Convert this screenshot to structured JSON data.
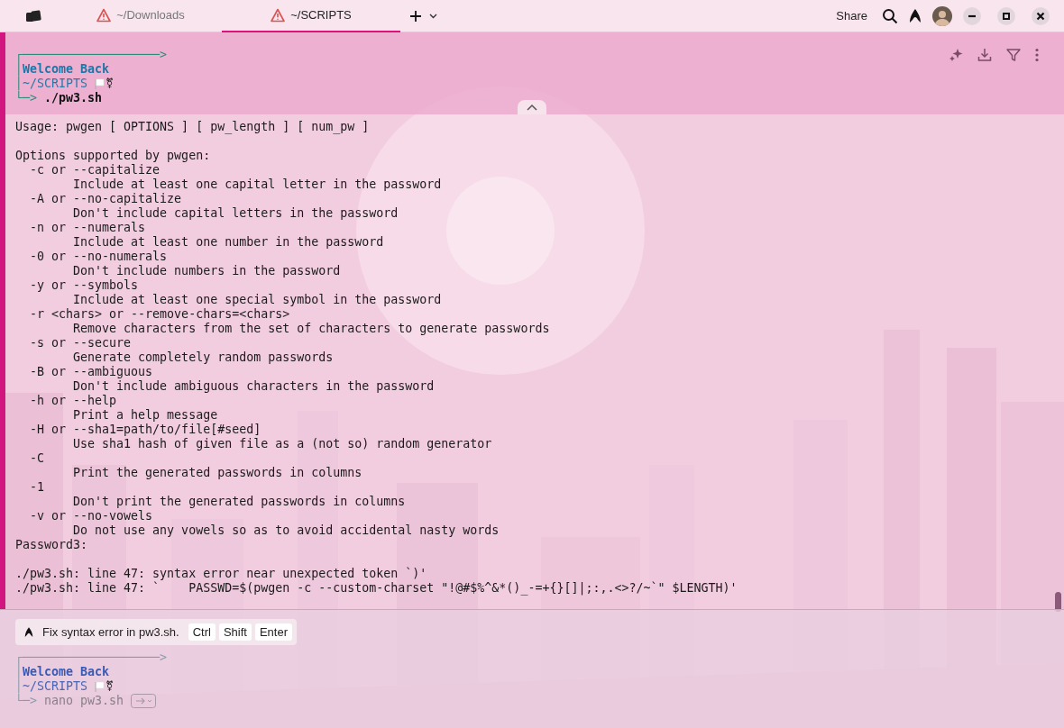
{
  "tabs": [
    {
      "label": "~/Downloads",
      "selected": false
    },
    {
      "label": "~/SCRIPTS",
      "selected": true
    }
  ],
  "titlebar": {
    "share": "Share"
  },
  "block": {
    "prompt": {
      "top": "┌───────────────────>",
      "greeting_prefix": "│",
      "greeting": "Welcome Back",
      "path_prefix": "│",
      "path": "~/SCRIPTS",
      "symbol": "⚧",
      "command_prefix": "└─>",
      "command": "./pw3.sh"
    },
    "output": [
      [
        "Usage: pwgen [ OPTIONS ] [ pw_length ] [ num_pw ]"
      ],
      [
        "Options supported by pwgen:",
        "  -c or --capitalize",
        "        Include at least one capital letter in the password",
        "  -A or --no-capitalize",
        "        Don't include capital letters in the password",
        "  -n or --numerals",
        "        Include at least one number in the password",
        "  -0 or --no-numerals",
        "        Don't include numbers in the password",
        "  -y or --symbols",
        "        Include at least one special symbol in the password",
        "  -r <chars> or --remove-chars=<chars>",
        "        Remove characters from the set of characters to generate passwords",
        "  -s or --secure",
        "        Generate completely random passwords",
        "  -B or --ambiguous",
        "        Don't include ambiguous characters in the password",
        "  -h or --help",
        "        Print a help message",
        "  -H or --sha1=path/to/file[#seed]",
        "        Use sha1 hash of given file as a (not so) random generator",
        "  -C",
        "        Print the generated passwords in columns",
        "  -1",
        "        Don't print the generated passwords in columns",
        "  -v or --no-vowels",
        "        Do not use any vowels so as to avoid accidental nasty words",
        "Password3:"
      ],
      [
        "./pw3.sh: line 47: syntax error near unexpected token `)'",
        "./pw3.sh: line 47: `    PASSWD=$(pwgen -c --custom-charset \"!@#$%^&*()_-=+{}[]|;:,.<>?/~`\" $LENGTH)'"
      ]
    ]
  },
  "suggestion": {
    "text": "Fix syntax error in pw3.sh.",
    "keys": [
      "Ctrl",
      "Shift",
      "Enter"
    ]
  },
  "input": {
    "prompt": {
      "top": "┌───────────────────>",
      "greeting_prefix": "│",
      "greeting": "Welcome Back",
      "path_prefix": "│",
      "path": "~/SCRIPTS",
      "symbol": "⚧",
      "command_prefix": "└─>"
    },
    "value": "nano pw3.sh"
  }
}
